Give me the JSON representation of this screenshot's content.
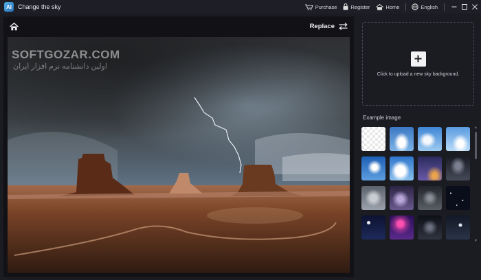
{
  "app": {
    "logo_text": "AI",
    "title": "Change the sky"
  },
  "titlebar": {
    "purchase": "Purchase",
    "register": "Register",
    "home": "Home",
    "language": "English"
  },
  "editor": {
    "replace_label": "Replace",
    "watermark": "SOFTGOZAR.COM",
    "watermark_sub": "اولین دانشنامه نرم افزار ایران"
  },
  "sidebar": {
    "upload_text": "Click to upload a new sky background.",
    "example_label": "Example image",
    "examples": [
      {
        "name": "transparent"
      },
      {
        "name": "blue-cumulus"
      },
      {
        "name": "blue-cloudy"
      },
      {
        "name": "light-blue"
      },
      {
        "name": "deep-blue"
      },
      {
        "name": "bright-clouds"
      },
      {
        "name": "purple-dusk"
      },
      {
        "name": "dark-storm"
      },
      {
        "name": "gray-overcast"
      },
      {
        "name": "purple-clouds"
      },
      {
        "name": "dark-clouds"
      },
      {
        "name": "night-stars"
      },
      {
        "name": "night-moon"
      },
      {
        "name": "pink-nebula"
      },
      {
        "name": "night-clouds"
      },
      {
        "name": "night-sky"
      }
    ]
  }
}
